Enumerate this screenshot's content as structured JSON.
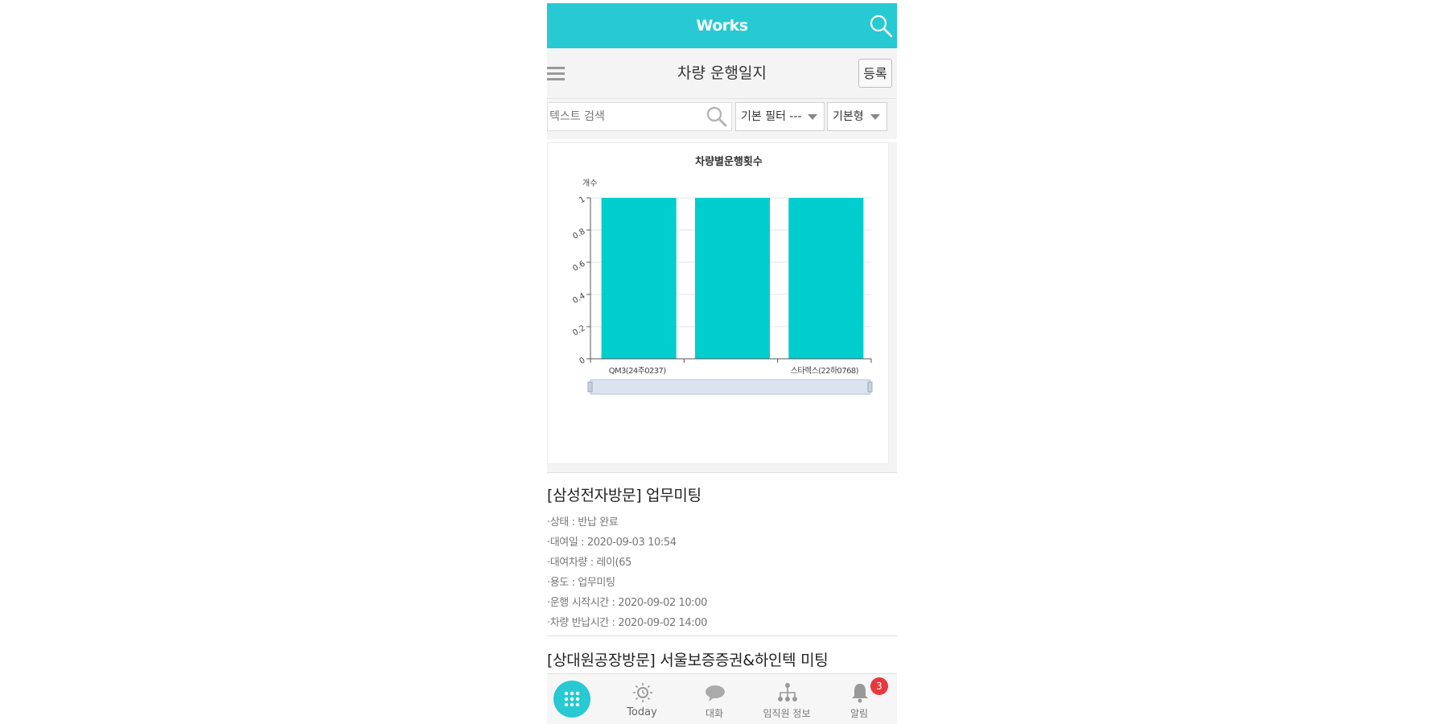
{
  "app": {
    "title": "Works"
  },
  "header": {
    "title": "차량 운행일지",
    "register_label": "등록"
  },
  "filters": {
    "search_placeholder": "텍스트 검색",
    "filter_select": "기본 필터 ---",
    "view_select": "기본형"
  },
  "chart_data": {
    "type": "bar",
    "title": "차량별운행횟수",
    "ylabel": "개수",
    "xlabel": "",
    "categories": [
      "QM3(24주0237)",
      "",
      "스타렉스(22하0768)"
    ],
    "values": [
      1,
      1,
      1
    ],
    "ylim": [
      0,
      1
    ],
    "yticks": [
      "0",
      "0.2",
      "0.4",
      "0.6",
      "0.8",
      "1"
    ],
    "grid": true,
    "color": "#00cdcd"
  },
  "list": [
    {
      "title": "[삼성전자방문] 업무미팅",
      "details": [
        "·상태 : 반납 완료",
        "·대여일 : 2020-09-03 10:54",
        "·대여차량 : 레이(65",
        "·용도 : 업무미팅",
        "·운행 시작시간 : 2020-09-02 10:00",
        "·차량 반납시간 : 2020-09-02 14:00"
      ]
    },
    {
      "title": "[상대원공장방문] 서울보증증권&하인텍 미팅",
      "details": []
    }
  ],
  "bottom_nav": {
    "today": "Today",
    "chat": "대화",
    "org": "임직원 정보",
    "alerts": "알림",
    "alert_count": "3"
  },
  "colors": {
    "accent": "#27c9d2",
    "bar": "#00cdcd",
    "badge": "#e8383d"
  }
}
